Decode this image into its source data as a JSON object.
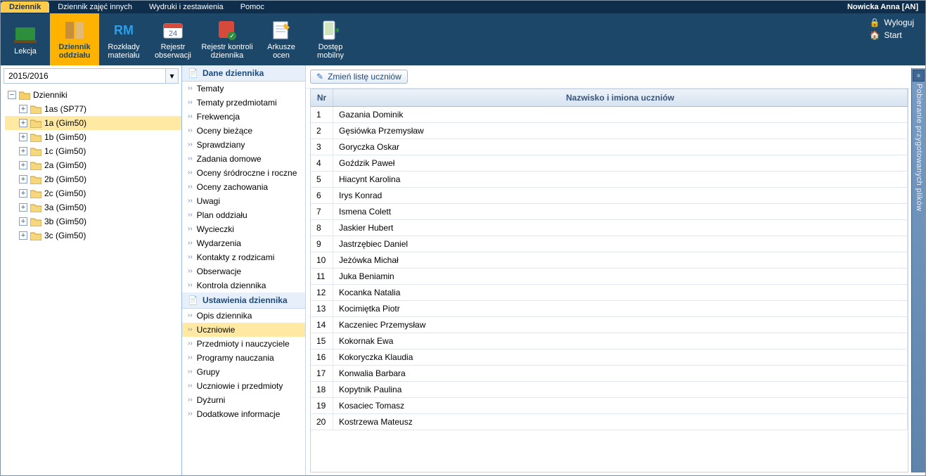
{
  "user": "Nowicka Anna [AN]",
  "tabs": [
    "Dziennik",
    "Dziennik zajęć innych",
    "Wydruki i zestawienia",
    "Pomoc"
  ],
  "ribbon": {
    "items": [
      "Lekcja",
      "Dziennik oddziału",
      "Rozkłady materiału",
      "Rejestr obserwacji",
      "Rejestr kontroli dziennika",
      "Arkusze ocen",
      "Dostęp mobilny"
    ],
    "right": {
      "logout": "Wyloguj",
      "start": "Start"
    }
  },
  "year": "2015/2016",
  "tree": {
    "root": "Dzienniki",
    "items": [
      "1as (SP77)",
      "1a (Gim50)",
      "1b (Gim50)",
      "1c (Gim50)",
      "2a (Gim50)",
      "2b (Gim50)",
      "2c (Gim50)",
      "3a (Gim50)",
      "3b (Gim50)",
      "3c (Gim50)"
    ],
    "selectedIndex": 1
  },
  "sections": {
    "s1": {
      "title": "Dane dziennika",
      "items": [
        "Tematy",
        "Tematy przedmiotami",
        "Frekwencja",
        "Oceny bieżące",
        "Sprawdziany",
        "Zadania domowe",
        "Oceny śródroczne i roczne",
        "Oceny zachowania",
        "Uwagi",
        "Plan oddziału",
        "Wycieczki",
        "Wydarzenia",
        "Kontakty z rodzicami",
        "Obserwacje",
        "Kontrola dziennika"
      ]
    },
    "s2": {
      "title": "Ustawienia dziennika",
      "items": [
        "Opis dziennika",
        "Uczniowie",
        "Przedmioty i nauczyciele",
        "Programy nauczania",
        "Grupy",
        "Uczniowie i przedmioty",
        "Dyżurni",
        "Dodatkowe informacje"
      ],
      "selectedIndex": 1
    }
  },
  "main": {
    "btn": "Zmień listę uczniów",
    "cols": {
      "nr": "Nr",
      "name": "Nazwisko i imiona uczniów"
    },
    "rows": [
      {
        "nr": 1,
        "name": "Gazania Dominik"
      },
      {
        "nr": 2,
        "name": "Gęsiówka Przemysław"
      },
      {
        "nr": 3,
        "name": "Goryczka Oskar"
      },
      {
        "nr": 4,
        "name": "Goździk Paweł"
      },
      {
        "nr": 5,
        "name": "Hiacynt Karolina"
      },
      {
        "nr": 6,
        "name": "Irys Konrad"
      },
      {
        "nr": 7,
        "name": "Ismena Colett"
      },
      {
        "nr": 8,
        "name": "Jaskier Hubert"
      },
      {
        "nr": 9,
        "name": "Jastrzębiec Daniel"
      },
      {
        "nr": 10,
        "name": "Jeżówka Michał"
      },
      {
        "nr": 11,
        "name": "Juka Beniamin"
      },
      {
        "nr": 12,
        "name": "Kocanka Natalia"
      },
      {
        "nr": 13,
        "name": "Kocimiętka Piotr"
      },
      {
        "nr": 14,
        "name": "Kaczeniec Przemysław"
      },
      {
        "nr": 15,
        "name": "Kokornak Ewa"
      },
      {
        "nr": 16,
        "name": "Kokoryczka Klaudia"
      },
      {
        "nr": 17,
        "name": "Konwalia Barbara"
      },
      {
        "nr": 18,
        "name": "Kopytnik Paulina"
      },
      {
        "nr": 19,
        "name": "Kosaciec Tomasz"
      },
      {
        "nr": 20,
        "name": "Kostrzewa Mateusz"
      }
    ]
  },
  "sidetab": "Pobieranie przygotowanych plików"
}
